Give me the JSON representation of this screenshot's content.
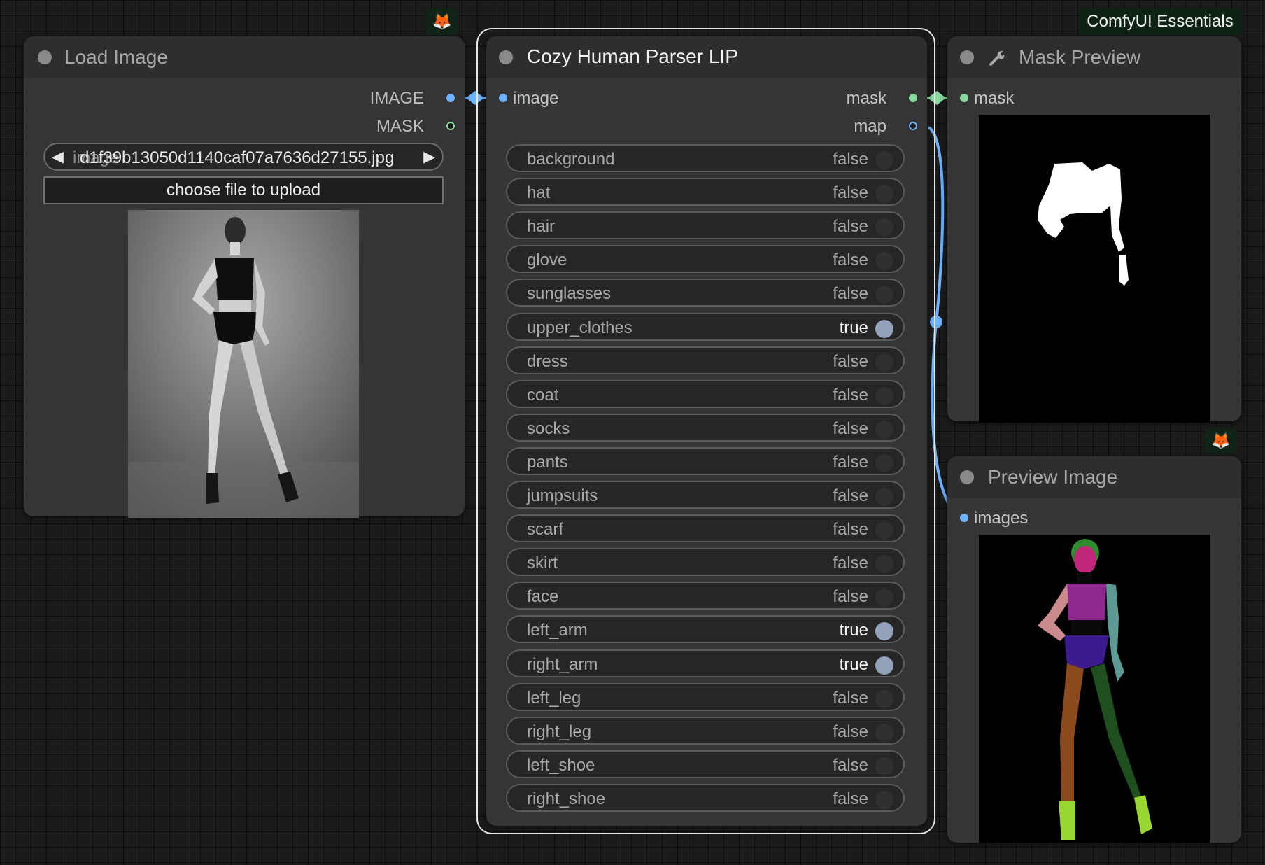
{
  "app": {
    "essentials_label": "ComfyUI Essentials",
    "badge_icon": "fox-icon",
    "badge_glyph": "🦊"
  },
  "load_image": {
    "title": "Load Image",
    "outputs": [
      "IMAGE",
      "MASK"
    ],
    "filename": "d1f39b13050d1140caf07a7636d27155.jpg",
    "filename_ghost": "image",
    "upload_label": "choose file to upload",
    "prev_glyph": "◀",
    "next_glyph": "▶"
  },
  "parser": {
    "title": "Cozy Human Parser LIP",
    "input_label": "image",
    "outputs": [
      "mask",
      "map"
    ],
    "toggles": [
      {
        "name": "background",
        "value": "false"
      },
      {
        "name": "hat",
        "value": "false"
      },
      {
        "name": "hair",
        "value": "false"
      },
      {
        "name": "glove",
        "value": "false"
      },
      {
        "name": "sunglasses",
        "value": "false"
      },
      {
        "name": "upper_clothes",
        "value": "true"
      },
      {
        "name": "dress",
        "value": "false"
      },
      {
        "name": "coat",
        "value": "false"
      },
      {
        "name": "socks",
        "value": "false"
      },
      {
        "name": "pants",
        "value": "false"
      },
      {
        "name": "jumpsuits",
        "value": "false"
      },
      {
        "name": "scarf",
        "value": "false"
      },
      {
        "name": "skirt",
        "value": "false"
      },
      {
        "name": "face",
        "value": "false"
      },
      {
        "name": "left_arm",
        "value": "true"
      },
      {
        "name": "right_arm",
        "value": "true"
      },
      {
        "name": "left_leg",
        "value": "false"
      },
      {
        "name": "right_leg",
        "value": "false"
      },
      {
        "name": "left_shoe",
        "value": "false"
      },
      {
        "name": "right_shoe",
        "value": "false"
      }
    ]
  },
  "mask_preview": {
    "title": "Mask Preview",
    "title_icon": "wrench-icon",
    "input_label": "mask"
  },
  "preview_image": {
    "title": "Preview Image",
    "input_label": "images"
  },
  "colors": {
    "image_link": "#6fb3ff",
    "mask_link": "#88d8a0",
    "toggle_on": "#93a2b9",
    "seg_hair": "#2e8b2e",
    "seg_face": "#c0287a",
    "seg_upper_clothes": "#8e2a8e",
    "seg_pants": "#3c1c8c",
    "seg_left_arm": "#c98b8b",
    "seg_right_arm": "#5e9a94",
    "seg_left_leg": "#8a4a1e",
    "seg_right_leg": "#1f4f1f",
    "seg_shoes": "#9ad632"
  }
}
